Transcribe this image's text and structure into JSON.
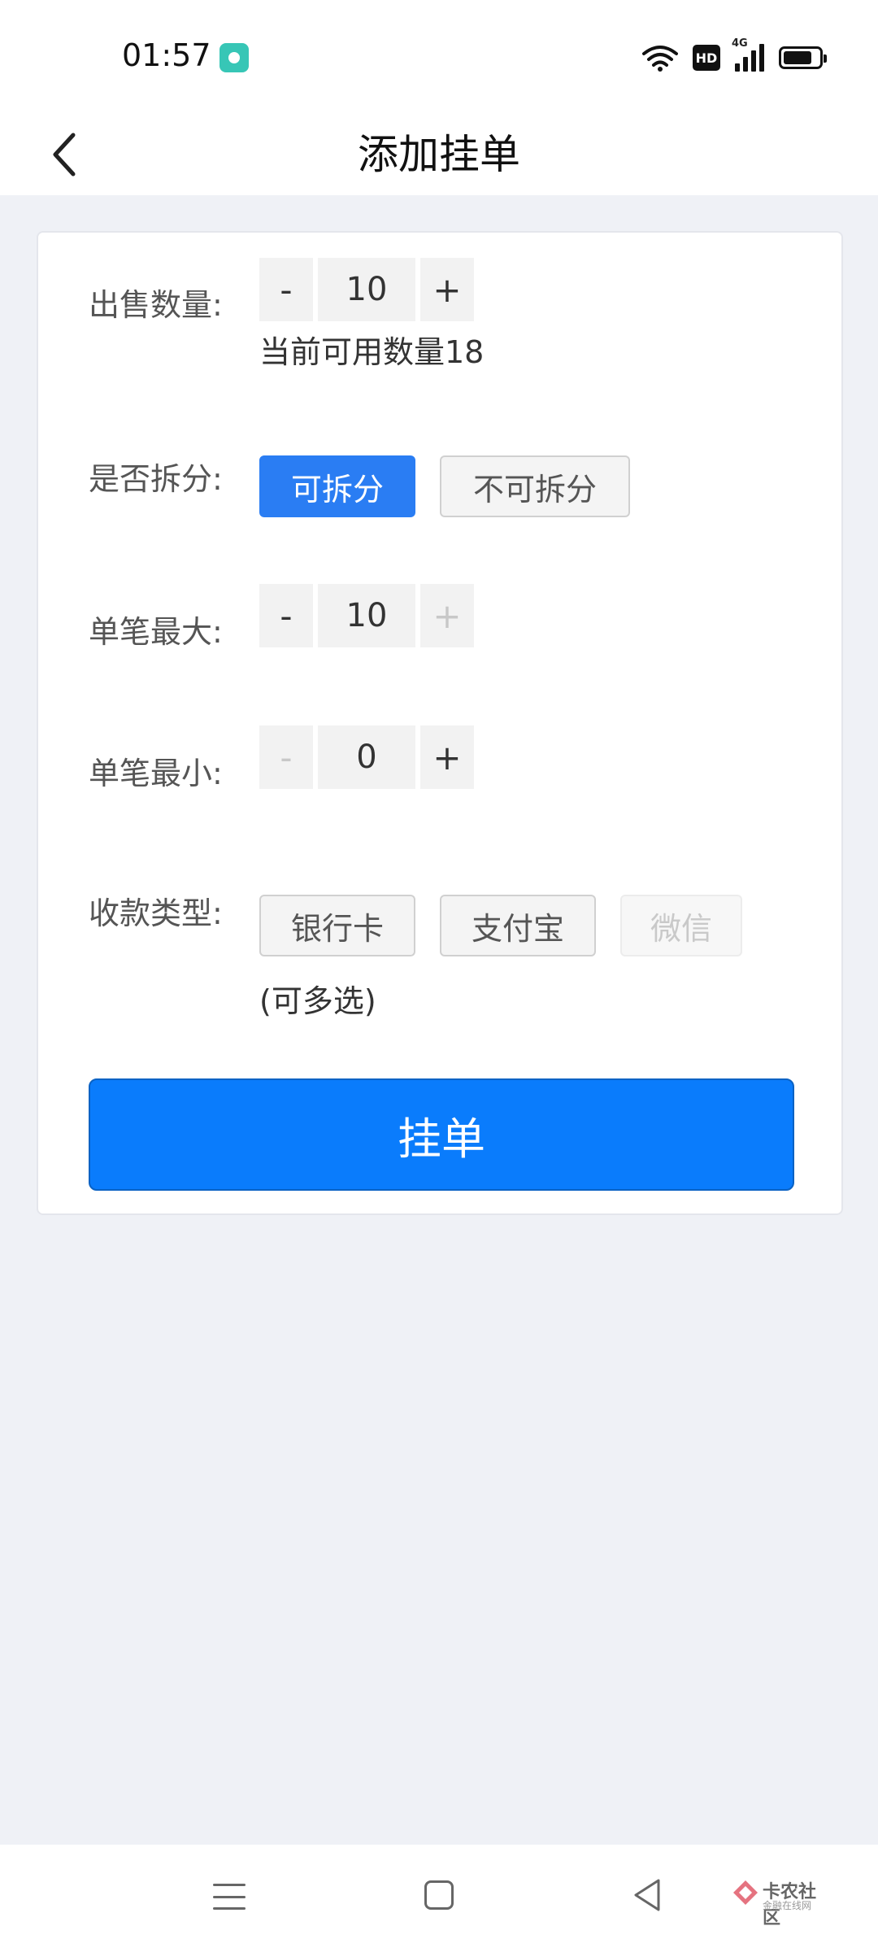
{
  "status_bar": {
    "time": "01:57",
    "hd_badge": "HD",
    "network": "4G",
    "icons": [
      "app-notification-icon",
      "wifi-icon",
      "hd-icon",
      "signal-icon",
      "battery-icon"
    ]
  },
  "header": {
    "title": "添加挂单",
    "back_icon": "chevron-left-icon"
  },
  "form": {
    "sell_quantity": {
      "label": "出售数量:",
      "minus": "-",
      "value": "10",
      "plus": "+",
      "hint": "当前可用数量18"
    },
    "split": {
      "label": "是否拆分:",
      "options": [
        "可拆分",
        "不可拆分"
      ],
      "selected": "可拆分"
    },
    "max_per_order": {
      "label": "单笔最大:",
      "minus": "-",
      "value": "10",
      "plus": "+",
      "plus_disabled": true
    },
    "min_per_order": {
      "label": "单笔最小:",
      "minus": "-",
      "value": "0",
      "plus": "+",
      "minus_disabled": true
    },
    "payment_type": {
      "label": "收款类型:",
      "options": [
        "银行卡",
        "支付宝",
        "微信"
      ],
      "disabled": [
        "微信"
      ],
      "note": "(可多选)"
    },
    "submit_label": "挂单"
  },
  "nav_bar": {
    "icons": [
      "menu-icon",
      "home-icon",
      "back-triangle-icon"
    ],
    "watermark_text": "卡农社区",
    "watermark_sub": "金融在线网"
  },
  "colors": {
    "accent": "#0a7cfc",
    "selected_option": "#2a7df3",
    "background": "#eff1f6"
  }
}
